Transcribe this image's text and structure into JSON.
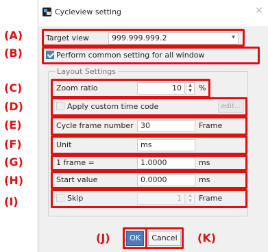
{
  "window": {
    "title": "Cycleview setting",
    "close_glyph": "✕"
  },
  "annotations": {
    "A": "(A)",
    "B": "(B)",
    "C": "(C)",
    "D": "(D)",
    "E": "(E)",
    "F": "(F)",
    "G": "(G)",
    "H": "(H)",
    "I": "(I)",
    "J": "(J)",
    "K": "(K)"
  },
  "target_view": {
    "label": "Target view",
    "value": "999.999.999.2",
    "arrow": "▾"
  },
  "common_setting": {
    "label": "Perform common setting for all window",
    "checked": true
  },
  "layout_settings": {
    "title": "Layout Settings",
    "zoom_ratio": {
      "label": "Zoom ratio",
      "value": "10",
      "unit": "%"
    },
    "custom_time_code": {
      "label": "Apply custom time code",
      "checked": false,
      "edit_label": "edit..."
    },
    "cycle_frame_number": {
      "label": "Cycle frame number",
      "value": "30",
      "unit": "Frame"
    },
    "unit": {
      "label": "Unit",
      "value": "ms"
    },
    "one_frame": {
      "label": "1 frame =",
      "value": "1.0000",
      "unit": "ms"
    },
    "start_value": {
      "label": "Start value",
      "value": "0.0000",
      "unit": "ms"
    },
    "skip": {
      "label": "Skip",
      "checked": false,
      "value": "1",
      "unit": "Frame"
    }
  },
  "buttons": {
    "ok": "OK",
    "cancel": "Cancel"
  },
  "colors": {
    "annotation_red": "#e01010",
    "ok_button": "#4c7cbd",
    "checkbox_checked": "#5c84b3"
  }
}
